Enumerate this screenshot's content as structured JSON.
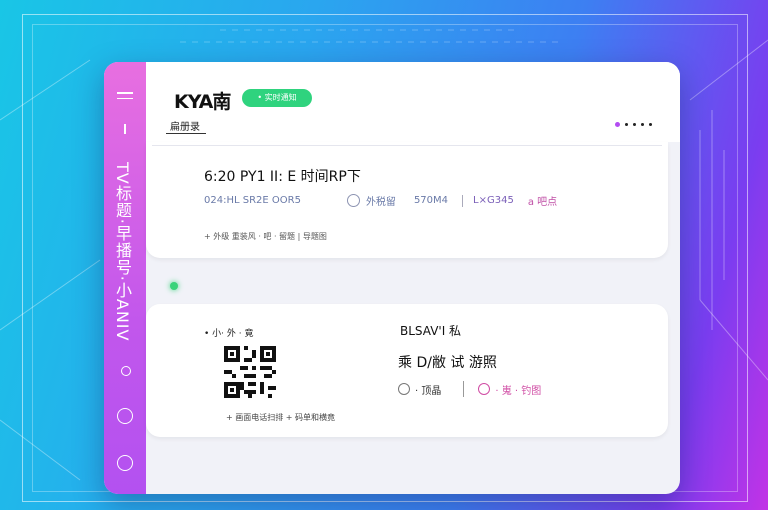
{
  "sidebar": {
    "vertical_text": "TV标题·早播号·小ANIV"
  },
  "header": {
    "logo": "KYA南",
    "badge": "• 实时通知",
    "subtitle": "扁册录"
  },
  "panel1": {
    "time": "6:20 PY1 II: E 时间RP下",
    "row_left": "024:HL SR2E OOR5",
    "option1": "外税留",
    "option2": "570M4",
    "option3": "L×G345",
    "option4": "a 吧点",
    "meta": "+ 外级 重装风 · 吧 · 留题 | 导题图"
  },
  "panel2": {
    "label": "• 小· 外 · 竟",
    "qr_caption": "+ 画面电话扫排 + 码单和横竟",
    "heading": "BLSAV'I 私",
    "big_text": "乘  D/敝 试 游照",
    "option1": "· 顶晶",
    "option2": "· 嵬 · 钓图"
  },
  "colors": {
    "sidebar_top": "#e86fe0",
    "sidebar_bottom": "#b351f0",
    "badge": "#2fd37e",
    "accent_dot": "#b34df2"
  }
}
